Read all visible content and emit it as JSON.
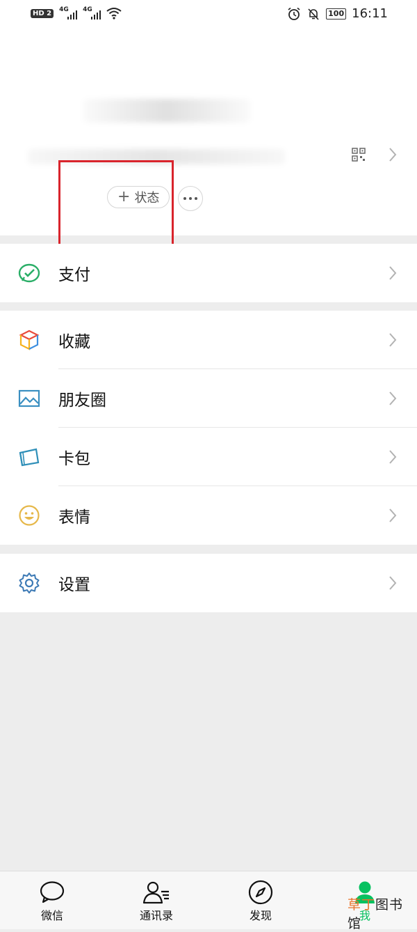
{
  "status_bar": {
    "network_badge": "HD 2",
    "signal_1": "4G",
    "signal_2": "4G",
    "battery": "100",
    "time": "16:11"
  },
  "profile": {
    "status_button_label": "+ 状态",
    "status_plus": "+",
    "status_text": "状态"
  },
  "menu": {
    "pay": {
      "label": "支付",
      "icon": "pay-icon",
      "color": "#2aae67"
    },
    "favorites": {
      "label": "收藏",
      "icon": "favorites-cube-icon"
    },
    "moments": {
      "label": "朋友圈",
      "icon": "moments-photo-icon",
      "color": "#3a8fc1"
    },
    "cards": {
      "label": "卡包",
      "icon": "card-wallet-icon",
      "color": "#2f8fb8"
    },
    "stickers": {
      "label": "表情",
      "icon": "smiley-icon",
      "color": "#e6b84a"
    },
    "settings": {
      "label": "设置",
      "icon": "settings-gear-icon",
      "color": "#3d7ab5"
    }
  },
  "tabbar": {
    "tabs": [
      {
        "label": "微信",
        "icon": "chat-bubble-icon"
      },
      {
        "label": "通讯录",
        "icon": "contacts-icon"
      },
      {
        "label": "发现",
        "icon": "compass-icon"
      },
      {
        "label": "我",
        "icon": "person-icon",
        "active": true
      }
    ],
    "active_color": "#07c160"
  },
  "watermark": {
    "accent": "草丁",
    "rest": "图书馆"
  }
}
